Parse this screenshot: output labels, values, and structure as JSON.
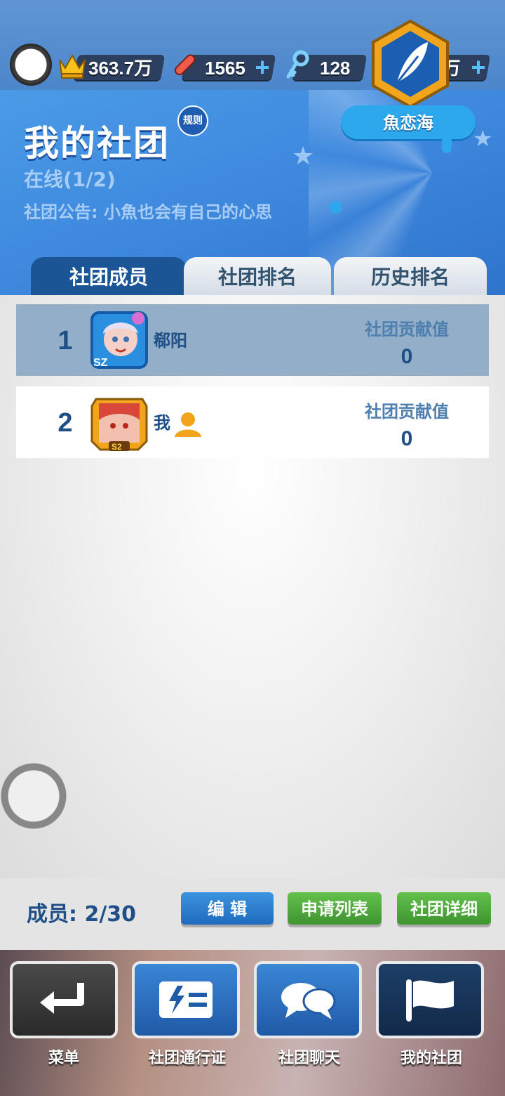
{
  "topbar": {
    "trophy_value": "363.7万",
    "board_value": "1565",
    "key_value": "128",
    "coin_value": "19.4万"
  },
  "header": {
    "title": "我的社团",
    "rules_label": "规则",
    "online": "在线(1/2)",
    "notice": "社团公告: 小魚也会有自己的心思",
    "club_name": "魚恋海"
  },
  "tabs": [
    {
      "label": "社团成员",
      "active": true
    },
    {
      "label": "社团排名",
      "active": false
    },
    {
      "label": "历史排名",
      "active": false
    }
  ],
  "members": [
    {
      "rank": "1",
      "name": "郗阳",
      "contrib_label": "社团贡献值",
      "contrib_value": "0",
      "avatar_tag": "SZ"
    },
    {
      "rank": "2",
      "name": "我",
      "contrib_label": "社团贡献值",
      "contrib_value": "0",
      "avatar_tag": "S2"
    }
  ],
  "footer": {
    "members_count": "成员: 2/30",
    "edit_label": "编 辑",
    "apply_label": "申请列表",
    "detail_label": "社团详细"
  },
  "nav": [
    {
      "label": "菜单",
      "icon": "return-arrow-icon"
    },
    {
      "label": "社团通行证",
      "icon": "pass-card-icon"
    },
    {
      "label": "社团聊天",
      "icon": "chat-bubbles-icon"
    },
    {
      "label": "我的社团",
      "icon": "flag-icon"
    }
  ],
  "colors": {
    "header_blue": "#3e88de",
    "tab_active": "#1b5596",
    "text_dark_blue": "#1e4f86",
    "btn_blue": "#1e6bbd",
    "btn_green": "#3f9430"
  }
}
